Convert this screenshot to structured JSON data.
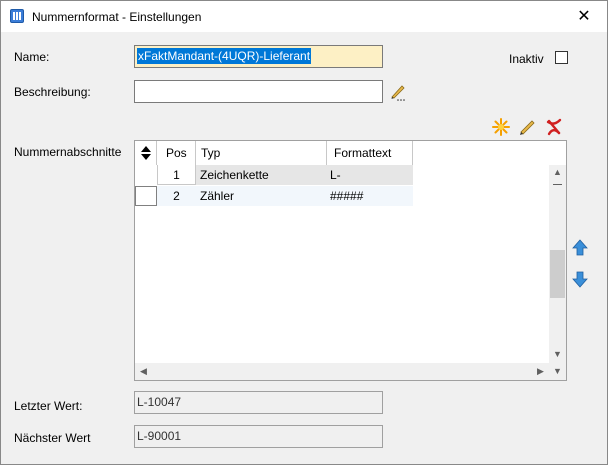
{
  "window": {
    "title": "Nummernformat - Einstellungen",
    "close_glyph": "✕"
  },
  "form": {
    "name_label": "Name:",
    "name_value": "xFaktMandant-(4UQR)-Lieferant",
    "inactive_label": "Inaktiv",
    "inactive_checked": false,
    "description_label": "Beschreibung:",
    "description_value": "",
    "sections_label": "Nummernabschnitte",
    "last_value_label": "Letzter Wert:",
    "last_value": "L-10047",
    "next_value_label": "Nächster Wert",
    "next_value": "L-90001"
  },
  "grid": {
    "columns": [
      "Pos",
      "Typ",
      "Formattext"
    ],
    "rows": [
      {
        "pos": "1",
        "typ": "Zeichenkette",
        "format": "L-"
      },
      {
        "pos": "2",
        "typ": "Zähler",
        "format": "#####"
      }
    ]
  },
  "icons": {
    "new": "star-burst-icon",
    "edit": "pencil-icon",
    "delete": "red-x-icon",
    "move_up": "arrow-up-icon",
    "move_down": "arrow-down-icon"
  },
  "colors": {
    "selection": "#0078d7",
    "name_field_bg": "#fdf0c5",
    "arrow_blue": "#3a8fd9",
    "delete_red": "#d02020",
    "new_orange": "#f5a000"
  }
}
